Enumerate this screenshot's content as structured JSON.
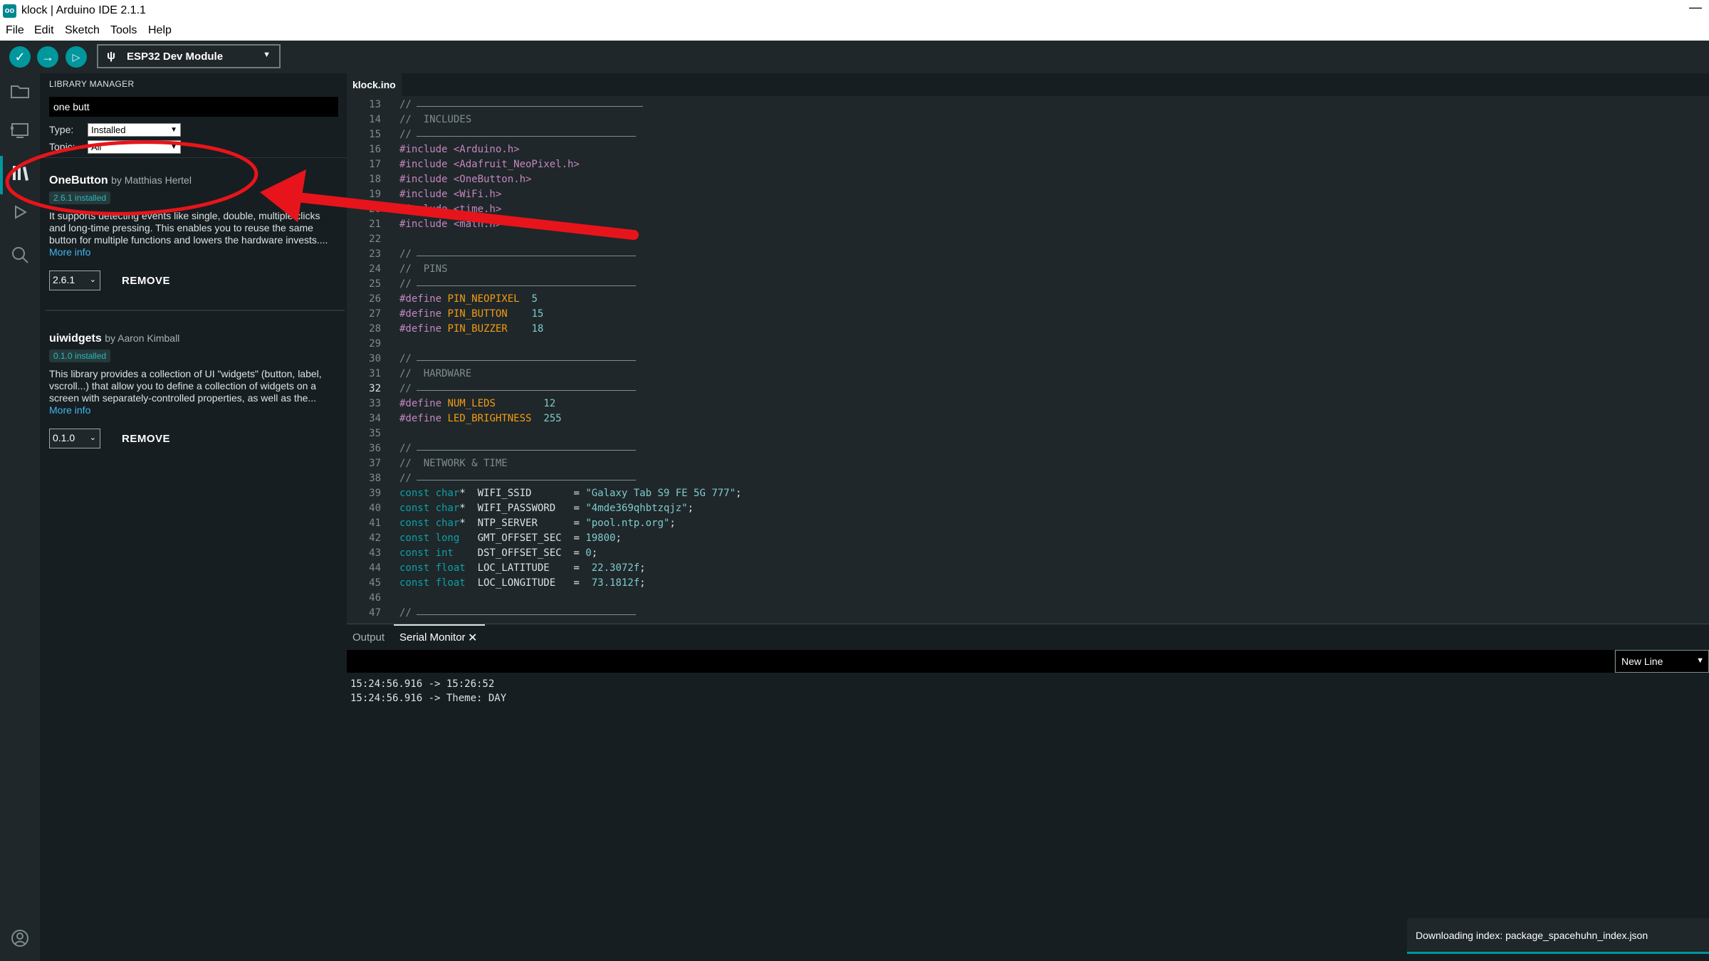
{
  "window": {
    "title": "klock | Arduino IDE 2.1.1",
    "app_icon": "oo"
  },
  "menu": [
    "File",
    "Edit",
    "Sketch",
    "Tools",
    "Help"
  ],
  "toolbar": {
    "verify_icon": "✓",
    "upload_icon": "→",
    "debug_icon": "▷",
    "board": "ESP32 Dev Module",
    "board_icon": "ψ",
    "dropdown_icon": "▼"
  },
  "library_manager": {
    "title": "LIBRARY MANAGER",
    "search_value": "one butt",
    "type_label": "Type:",
    "type_value": "Installed",
    "topic_label": "Topic:",
    "topic_value": "All",
    "libraries": [
      {
        "name": "OneButton",
        "author": "by Matthias Hertel",
        "badge": "2.6.1 installed",
        "description": "It supports detecting events like single, double, multiple clicks and long-time pressing. This enables you to reuse the same button for multiple functions and lowers the hardware invests....",
        "more_info": "More info",
        "version": "2.6.1",
        "action": "REMOVE"
      },
      {
        "name": "uiwidgets",
        "author": "by Aaron Kimball",
        "badge": "0.1.0 installed",
        "description": "This library provides a collection of UI \"widgets\" (button, label, vscroll...) that allow you to define a collection of widgets on a screen with separately-controlled properties, as well as the...",
        "more_info": "More info",
        "version": "0.1.0",
        "action": "REMOVE"
      }
    ]
  },
  "editor": {
    "tab": "klock.ino",
    "current_line": "32",
    "lines": [
      {
        "n": "13",
        "tokens": [
          [
            "c-com",
            "// "
          ]
        ],
        "rule": 416
      },
      {
        "n": "14",
        "tokens": [
          [
            "c-com",
            "//  INCLUDES"
          ]
        ]
      },
      {
        "n": "15",
        "tokens": [
          [
            "c-com",
            "// "
          ]
        ],
        "rule": 406
      },
      {
        "n": "16",
        "tokens": [
          [
            "c-pp",
            "#include <Arduino.h>"
          ]
        ]
      },
      {
        "n": "17",
        "tokens": [
          [
            "c-pp",
            "#include <Adafruit_NeoPixel.h>"
          ]
        ]
      },
      {
        "n": "18",
        "tokens": [
          [
            "c-pp",
            "#include <OneButton.h>"
          ]
        ]
      },
      {
        "n": "19",
        "tokens": [
          [
            "c-pp",
            "#include <WiFi.h>"
          ]
        ]
      },
      {
        "n": "20",
        "tokens": [
          [
            "c-pp",
            "#include <time.h>"
          ]
        ]
      },
      {
        "n": "21",
        "tokens": [
          [
            "c-pp",
            "#include <math.h>"
          ]
        ]
      },
      {
        "n": "22",
        "tokens": []
      },
      {
        "n": "23",
        "tokens": [
          [
            "c-com",
            "// "
          ]
        ],
        "rule": 406
      },
      {
        "n": "24",
        "tokens": [
          [
            "c-com",
            "//  PINS"
          ]
        ]
      },
      {
        "n": "25",
        "tokens": [
          [
            "c-com",
            "// "
          ]
        ],
        "rule": 406
      },
      {
        "n": "26",
        "tokens": [
          [
            "c-pp",
            "#define "
          ],
          [
            "c-con",
            "PIN_NEOPIXEL"
          ],
          [
            "c-id",
            "  "
          ],
          [
            "c-num",
            "5"
          ]
        ]
      },
      {
        "n": "27",
        "tokens": [
          [
            "c-pp",
            "#define "
          ],
          [
            "c-con",
            "PIN_BUTTON"
          ],
          [
            "c-id",
            "    "
          ],
          [
            "c-num",
            "15"
          ]
        ]
      },
      {
        "n": "28",
        "tokens": [
          [
            "c-pp",
            "#define "
          ],
          [
            "c-con",
            "PIN_BUZZER"
          ],
          [
            "c-id",
            "    "
          ],
          [
            "c-num",
            "18"
          ]
        ]
      },
      {
        "n": "29",
        "tokens": []
      },
      {
        "n": "30",
        "tokens": [
          [
            "c-com",
            "// "
          ]
        ],
        "rule": 406
      },
      {
        "n": "31",
        "tokens": [
          [
            "c-com",
            "//  HARDWARE"
          ]
        ]
      },
      {
        "n": "32",
        "tokens": [
          [
            "c-com",
            "// "
          ]
        ],
        "rule": 406
      },
      {
        "n": "33",
        "tokens": [
          [
            "c-pp",
            "#define "
          ],
          [
            "c-con",
            "NUM_LEDS"
          ],
          [
            "c-id",
            "        "
          ],
          [
            "c-num",
            "12"
          ]
        ]
      },
      {
        "n": "34",
        "tokens": [
          [
            "c-pp",
            "#define "
          ],
          [
            "c-con",
            "LED_BRIGHTNESS"
          ],
          [
            "c-id",
            "  "
          ],
          [
            "c-num",
            "255"
          ]
        ]
      },
      {
        "n": "35",
        "tokens": []
      },
      {
        "n": "36",
        "tokens": [
          [
            "c-com",
            "// "
          ]
        ],
        "rule": 406
      },
      {
        "n": "37",
        "tokens": [
          [
            "c-com",
            "//  NETWORK & TIME"
          ]
        ]
      },
      {
        "n": "38",
        "tokens": [
          [
            "c-com",
            "// "
          ]
        ],
        "rule": 406
      },
      {
        "n": "39",
        "tokens": [
          [
            "c-kw",
            "const char"
          ],
          [
            "c-id",
            "*  WIFI_SSID       = "
          ],
          [
            "c-str",
            "\"Galaxy Tab S9 FE 5G 777\""
          ],
          [
            "c-id",
            ";"
          ]
        ]
      },
      {
        "n": "40",
        "tokens": [
          [
            "c-kw",
            "const char"
          ],
          [
            "c-id",
            "*  WIFI_PASSWORD   = "
          ],
          [
            "c-str",
            "\"4mde369qhbtzqjz\""
          ],
          [
            "c-id",
            ";"
          ]
        ]
      },
      {
        "n": "41",
        "tokens": [
          [
            "c-kw",
            "const char"
          ],
          [
            "c-id",
            "*  NTP_SERVER      = "
          ],
          [
            "c-str",
            "\"pool.ntp.org\""
          ],
          [
            "c-id",
            ";"
          ]
        ]
      },
      {
        "n": "42",
        "tokens": [
          [
            "c-kw",
            "const long"
          ],
          [
            "c-id",
            "   GMT_OFFSET_SEC  = "
          ],
          [
            "c-num",
            "19800"
          ],
          [
            "c-id",
            ";"
          ]
        ]
      },
      {
        "n": "43",
        "tokens": [
          [
            "c-kw",
            "const int"
          ],
          [
            "c-id",
            "    DST_OFFSET_SEC  = "
          ],
          [
            "c-num",
            "0"
          ],
          [
            "c-id",
            ";"
          ]
        ]
      },
      {
        "n": "44",
        "tokens": [
          [
            "c-kw",
            "const float"
          ],
          [
            "c-id",
            "  LOC_LATITUDE    =  "
          ],
          [
            "c-num",
            "22.3072f"
          ],
          [
            "c-id",
            ";"
          ]
        ]
      },
      {
        "n": "45",
        "tokens": [
          [
            "c-kw",
            "const float"
          ],
          [
            "c-id",
            "  LOC_LONGITUDE   =  "
          ],
          [
            "c-num",
            "73.1812f"
          ],
          [
            "c-id",
            ";"
          ]
        ]
      },
      {
        "n": "46",
        "tokens": []
      },
      {
        "n": "47",
        "tokens": [
          [
            "c-com",
            "// "
          ]
        ],
        "rule": 406
      }
    ]
  },
  "panel": {
    "tab_output": "Output",
    "tab_serial": "Serial Monitor",
    "close_icon": "✕",
    "line_ending": "New Line",
    "serial_lines": [
      "15:24:56.916 -> 15:26:52",
      "15:24:56.916 -> Theme: DAY"
    ]
  },
  "notification": {
    "text": "Downloading index: package_spacehuhn_index.json"
  },
  "colors": {
    "accent": "#00979d",
    "annotation": "#e8141b",
    "background": "#171e21"
  },
  "icons": [
    "folder-icon",
    "board-icon",
    "library-icon",
    "debug-icon",
    "search-icon",
    "account-icon"
  ]
}
